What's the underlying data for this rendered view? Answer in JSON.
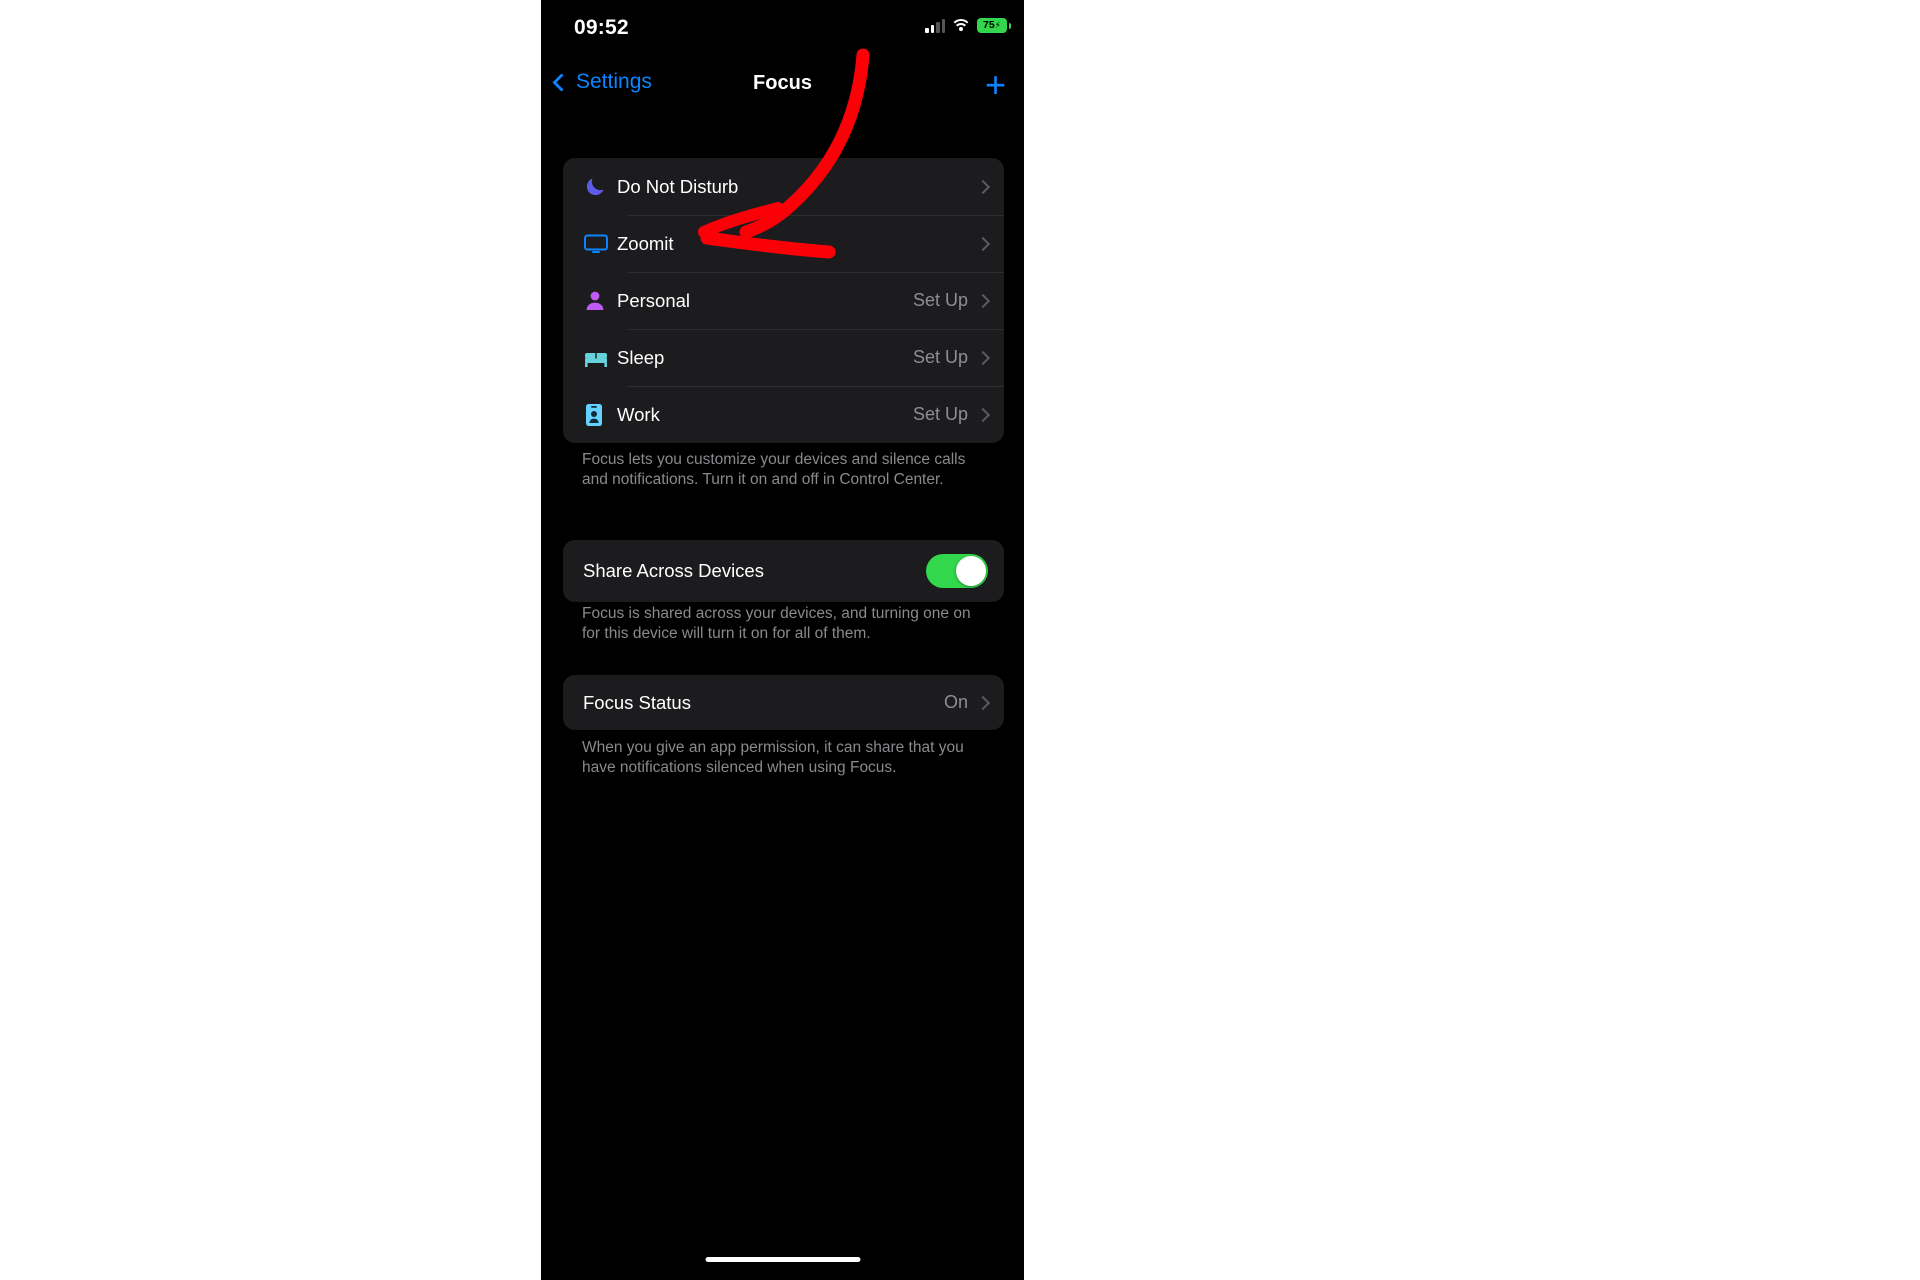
{
  "status_bar": {
    "time": "09:52",
    "battery_level": "75",
    "battery_charging_glyph": "⚡",
    "cellular_icon": "cellular-bars-icon",
    "wifi_icon": "wifi-icon",
    "battery_icon": "battery-icon"
  },
  "nav": {
    "back_label": "Settings",
    "title": "Focus",
    "add_label": "+"
  },
  "focus_list": {
    "items": [
      {
        "label": "Do Not Disturb",
        "value": "",
        "icon": "moon-icon",
        "color": "#5e5ce6"
      },
      {
        "label": "Zoomit",
        "value": "",
        "icon": "display-icon",
        "color": "#0a84ff"
      },
      {
        "label": "Personal",
        "value": "Set Up",
        "icon": "person-icon",
        "color": "#bf5af2"
      },
      {
        "label": "Sleep",
        "value": "Set Up",
        "icon": "bed-icon",
        "color": "#64d2d8"
      },
      {
        "label": "Work",
        "value": "Set Up",
        "icon": "id-badge-icon",
        "color": "#64d2ff"
      }
    ],
    "footer": "Focus lets you customize your devices and silence calls and notifications. Turn it on and off in Control Center."
  },
  "share_section": {
    "label": "Share Across Devices",
    "enabled": true,
    "footer": "Focus is shared across your devices, and turning one on for this device will turn it on for all of them."
  },
  "focus_status_section": {
    "label": "Focus Status",
    "value": "On",
    "footer": "When you give an app permission, it can share that you have notifications silenced when using Focus."
  },
  "annotation": {
    "type": "red-arrow",
    "color": "#fb0007",
    "points_to": "Zoomit"
  },
  "colors": {
    "accent": "#0a84ff",
    "card": "#1c1c1e",
    "background": "#000000",
    "toggle_on": "#32d74b",
    "secondary_text": "#8e8e93"
  }
}
